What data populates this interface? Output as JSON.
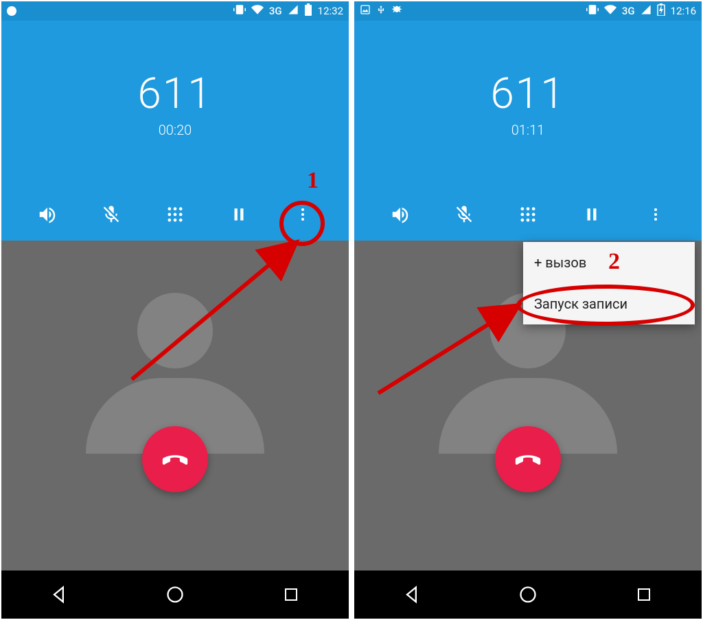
{
  "left": {
    "statusbar": {
      "network": "3G",
      "time": "12:32"
    },
    "call": {
      "number": "611",
      "timer": "00:20"
    },
    "annotation": {
      "label": "1"
    }
  },
  "right": {
    "statusbar": {
      "network": "3G",
      "time": "12:16"
    },
    "call": {
      "number": "611",
      "timer": "01:11"
    },
    "menu": {
      "add_call": "+ вызов",
      "start_record": "Запуск записи"
    },
    "annotation": {
      "label": "2"
    }
  }
}
